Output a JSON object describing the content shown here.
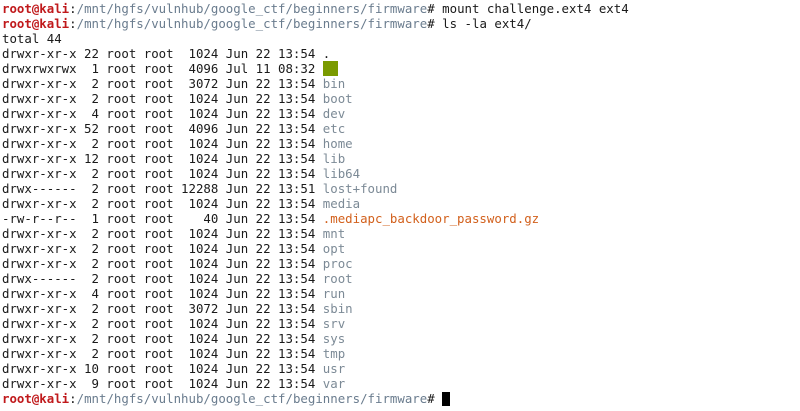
{
  "prompt": {
    "user": "root@kali",
    "sep": ":",
    "path": "/mnt/hgfs/vulnhub/google_ctf/beginners/firmware",
    "symbol": "#"
  },
  "commands": [
    "mount challenge.ext4 ext4",
    "ls -la ext4/"
  ],
  "total": "total 44",
  "entries": [
    {
      "meta": "drwxr-xr-x 22 root root  1024 Jun 22 13:54 ",
      "name": ".",
      "style": "plain"
    },
    {
      "meta": "drwxrwxrwx  1 root root  4096 Jul 11 08:32 ",
      "name": "..",
      "style": "highlight"
    },
    {
      "meta": "drwxr-xr-x  2 root root  3072 Jun 22 13:54 ",
      "name": "bin",
      "style": "dir"
    },
    {
      "meta": "drwxr-xr-x  2 root root  1024 Jun 22 13:54 ",
      "name": "boot",
      "style": "dir"
    },
    {
      "meta": "drwxr-xr-x  4 root root  1024 Jun 22 13:54 ",
      "name": "dev",
      "style": "dir"
    },
    {
      "meta": "drwxr-xr-x 52 root root  4096 Jun 22 13:54 ",
      "name": "etc",
      "style": "dir"
    },
    {
      "meta": "drwxr-xr-x  2 root root  1024 Jun 22 13:54 ",
      "name": "home",
      "style": "dir"
    },
    {
      "meta": "drwxr-xr-x 12 root root  1024 Jun 22 13:54 ",
      "name": "lib",
      "style": "dir"
    },
    {
      "meta": "drwxr-xr-x  2 root root  1024 Jun 22 13:54 ",
      "name": "lib64",
      "style": "dir"
    },
    {
      "meta": "drwx------  2 root root 12288 Jun 22 13:51 ",
      "name": "lost+found",
      "style": "dir"
    },
    {
      "meta": "drwxr-xr-x  2 root root  1024 Jun 22 13:54 ",
      "name": "media",
      "style": "dir"
    },
    {
      "meta": "-rw-r--r--  1 root root    40 Jun 22 13:54 ",
      "name": ".mediapc_backdoor_password.gz",
      "style": "archive"
    },
    {
      "meta": "drwxr-xr-x  2 root root  1024 Jun 22 13:54 ",
      "name": "mnt",
      "style": "dir"
    },
    {
      "meta": "drwxr-xr-x  2 root root  1024 Jun 22 13:54 ",
      "name": "opt",
      "style": "dir"
    },
    {
      "meta": "drwxr-xr-x  2 root root  1024 Jun 22 13:54 ",
      "name": "proc",
      "style": "dir"
    },
    {
      "meta": "drwx------  2 root root  1024 Jun 22 13:54 ",
      "name": "root",
      "style": "dir"
    },
    {
      "meta": "drwxr-xr-x  4 root root  1024 Jun 22 13:54 ",
      "name": "run",
      "style": "dir"
    },
    {
      "meta": "drwxr-xr-x  2 root root  3072 Jun 22 13:54 ",
      "name": "sbin",
      "style": "dir"
    },
    {
      "meta": "drwxr-xr-x  2 root root  1024 Jun 22 13:54 ",
      "name": "srv",
      "style": "dir"
    },
    {
      "meta": "drwxr-xr-x  2 root root  1024 Jun 22 13:54 ",
      "name": "sys",
      "style": "dir"
    },
    {
      "meta": "drwxr-xr-x  2 root root  1024 Jun 22 13:54 ",
      "name": "tmp",
      "style": "dir"
    },
    {
      "meta": "drwxr-xr-x 10 root root  1024 Jun 22 13:54 ",
      "name": "usr",
      "style": "dir"
    },
    {
      "meta": "drwxr-xr-x  9 root root  1024 Jun 22 13:54 ",
      "name": "var",
      "style": "dir"
    }
  ],
  "colors": {
    "user": "#c0191b",
    "path": "#6a7c8e",
    "dir": "#7c8a96",
    "archive": "#d2601c",
    "highlight": "#7a9a00"
  }
}
